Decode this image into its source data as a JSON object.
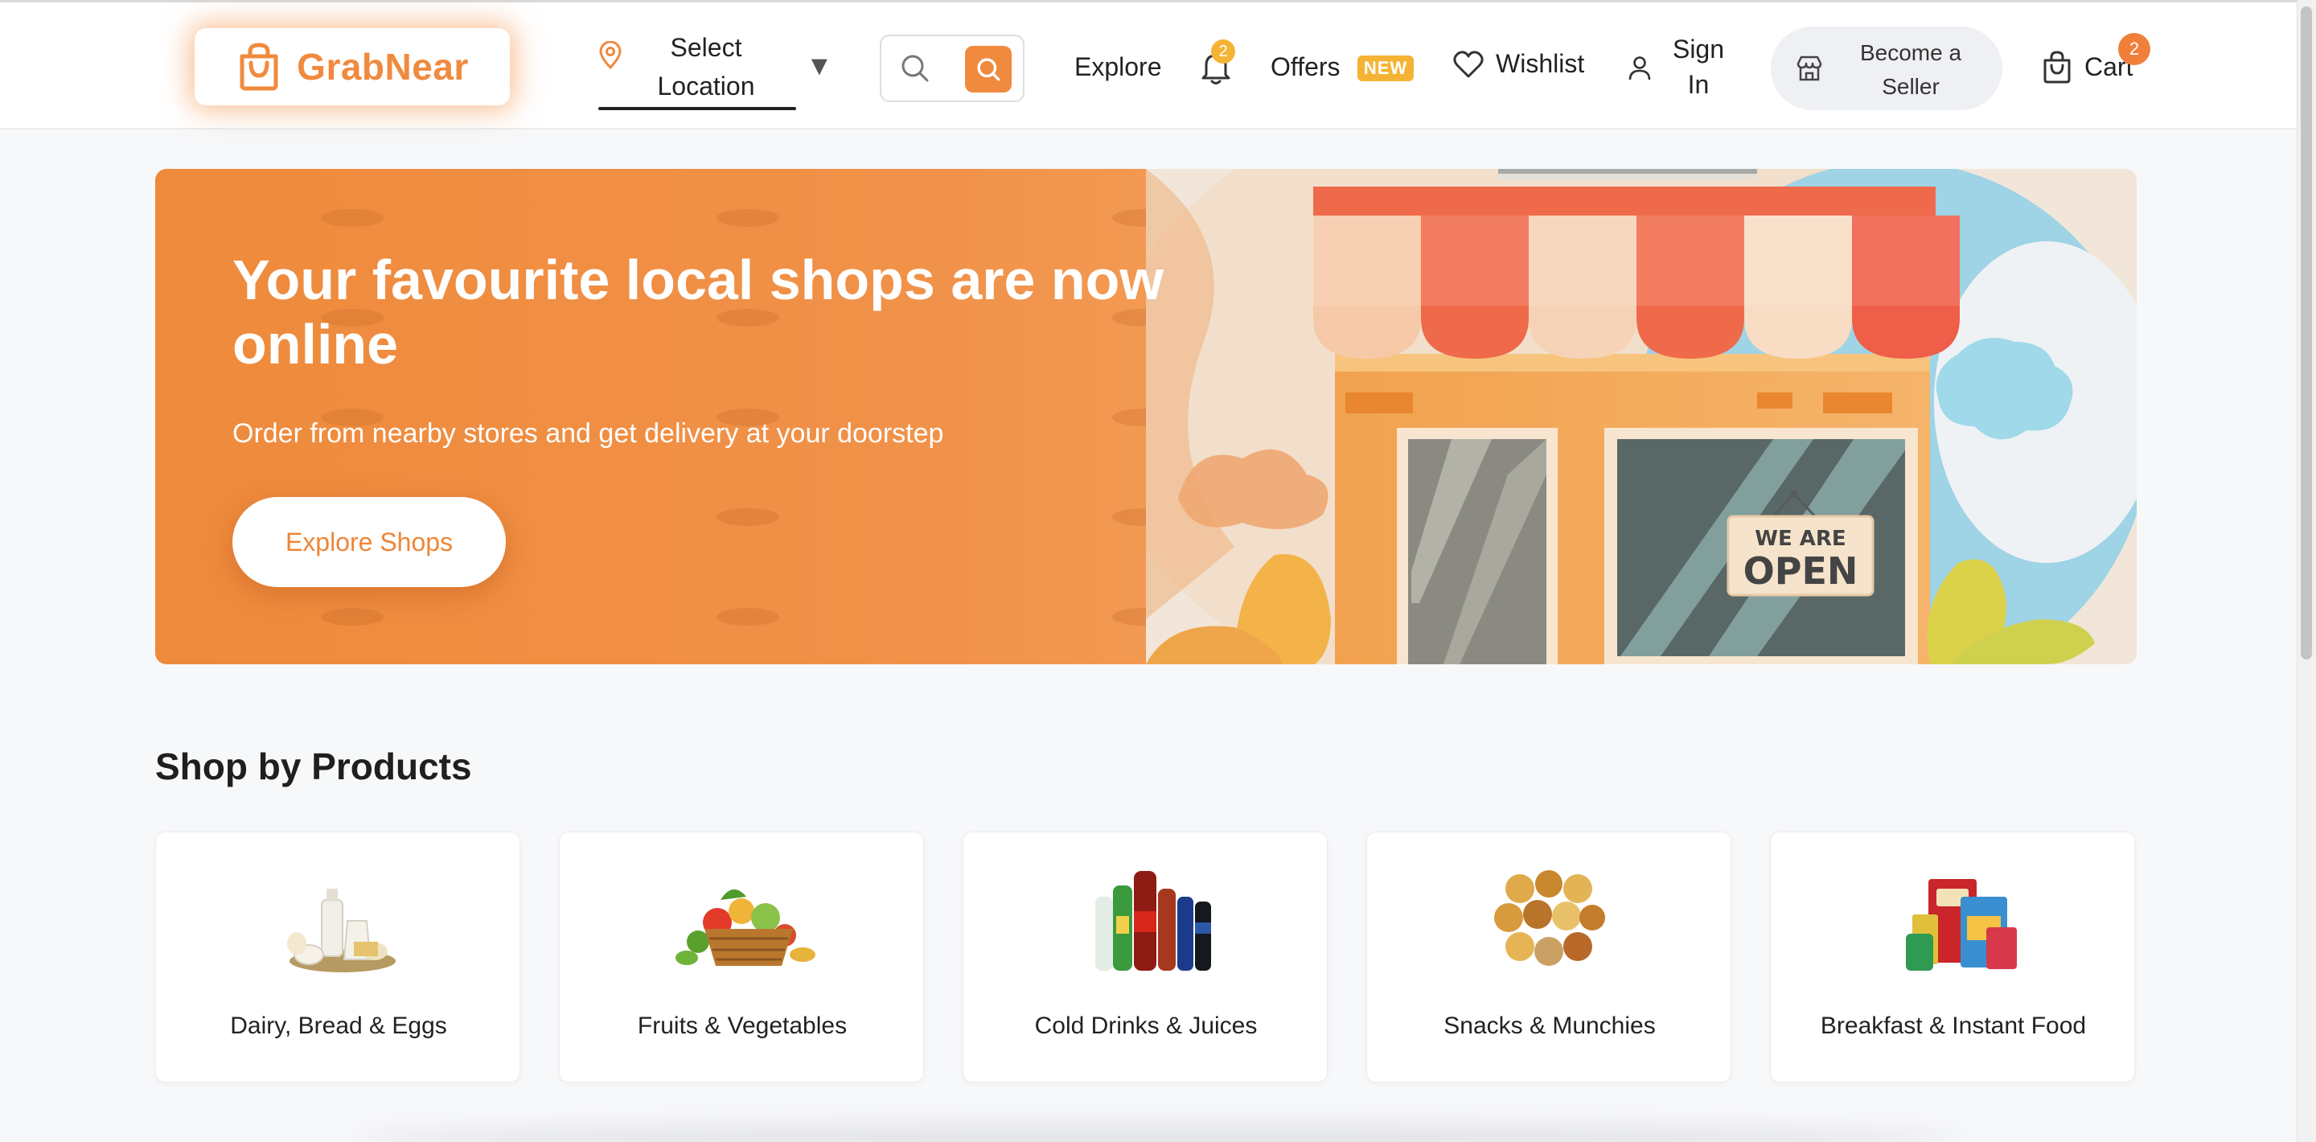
{
  "brand": {
    "name": "GrabNear",
    "accent": "#f08a3e"
  },
  "header": {
    "location_label": "Select Location",
    "search_placeholder": "",
    "explore": "Explore",
    "notifications_count": "2",
    "offers": "Offers",
    "offers_badge": "NEW",
    "wishlist": "Wishlist",
    "sign_in": "Sign In",
    "become_seller": "Become a Seller",
    "cart": "Cart",
    "cart_count": "2"
  },
  "hero": {
    "title": "Your favourite local shops are now online",
    "subtitle": "Order from nearby stores and get delivery at your doorstep",
    "cta": "Explore Shops",
    "sign_line1": "WE ARE",
    "sign_line2": "OPEN"
  },
  "products": {
    "title": "Shop by Products",
    "items": [
      {
        "label": "Dairy, Bread & Eggs"
      },
      {
        "label": "Fruits & Vegetables"
      },
      {
        "label": "Cold Drinks & Juices"
      },
      {
        "label": "Snacks & Munchies"
      },
      {
        "label": "Breakfast & Instant Food"
      }
    ]
  }
}
